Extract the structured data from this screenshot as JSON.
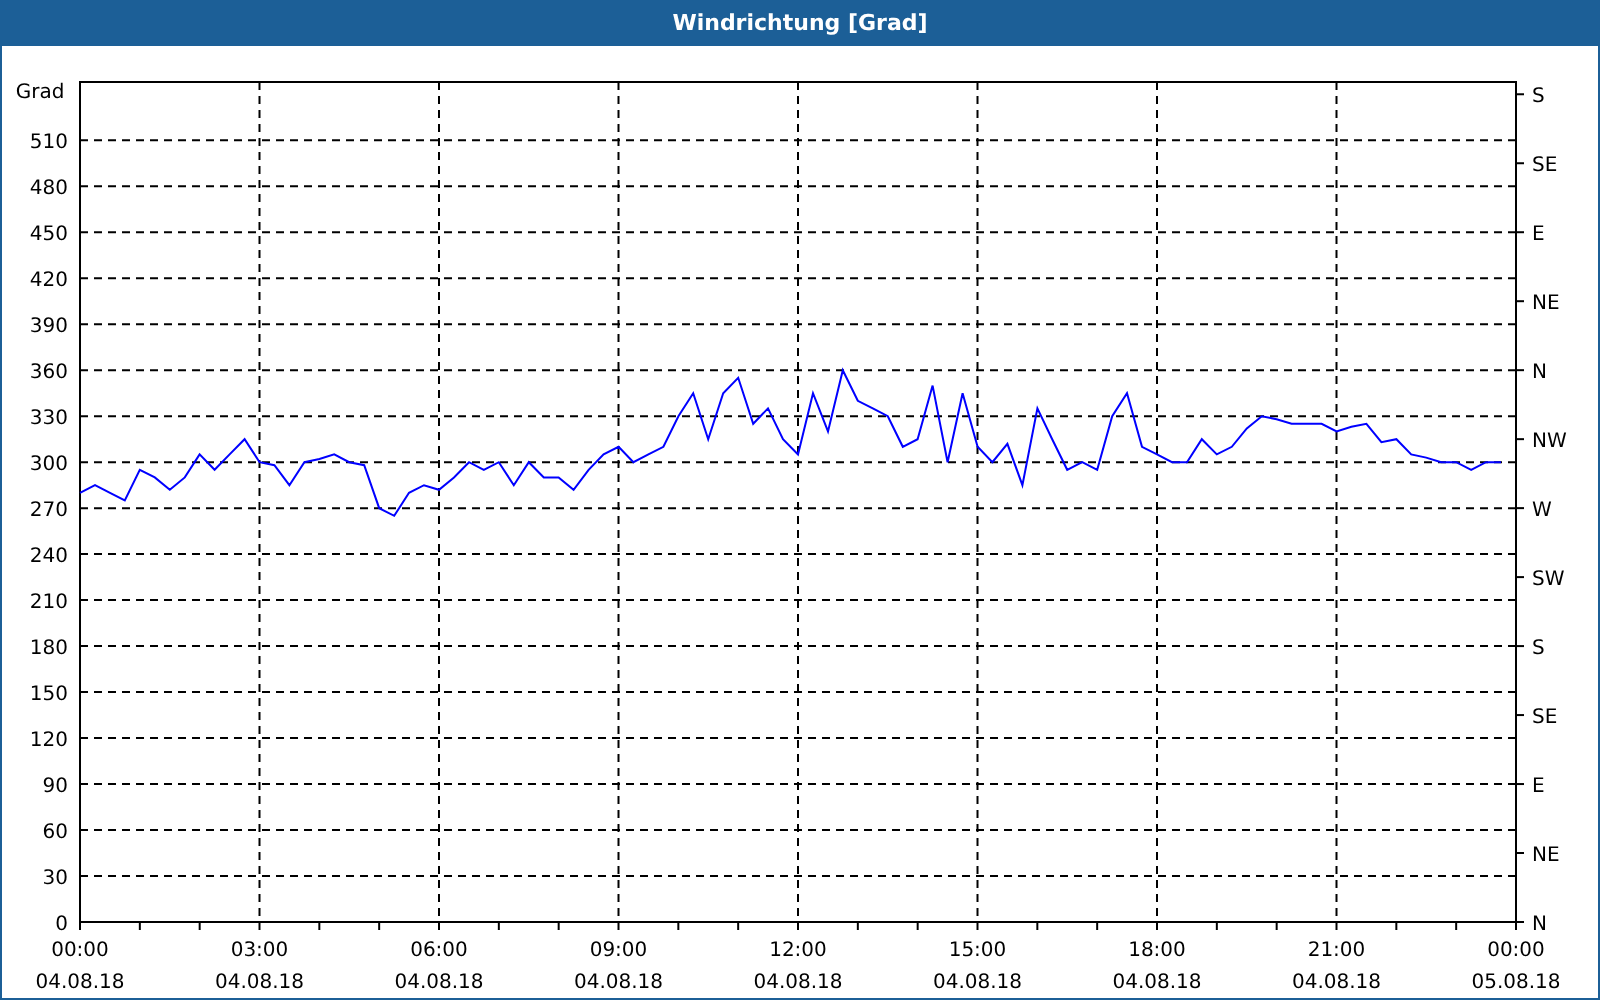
{
  "window": {
    "title": "Windrichtung [Grad]"
  },
  "chart": {
    "chart_data": {
      "type": "line",
      "ylabel": "Grad",
      "grid": true,
      "x": [
        0,
        0.25,
        0.5,
        0.75,
        1,
        1.25,
        1.5,
        1.75,
        2,
        2.25,
        2.5,
        2.75,
        3,
        3.25,
        3.5,
        3.75,
        4,
        4.25,
        4.5,
        4.75,
        5,
        5.25,
        5.5,
        5.75,
        6,
        6.25,
        6.5,
        6.75,
        7,
        7.25,
        7.5,
        7.75,
        8,
        8.25,
        8.5,
        8.75,
        9,
        9.25,
        9.5,
        9.75,
        10,
        10.25,
        10.5,
        10.75,
        11,
        11.25,
        11.5,
        11.75,
        12,
        12.25,
        12.5,
        12.75,
        13,
        13.25,
        13.5,
        13.75,
        14,
        14.25,
        14.5,
        14.75,
        15,
        15.25,
        15.5,
        15.75,
        16,
        16.25,
        16.5,
        16.75,
        17,
        17.25,
        17.5,
        17.75,
        18,
        18.25,
        18.5,
        18.75,
        19,
        19.25,
        19.5,
        19.75,
        20,
        20.25,
        20.5,
        20.75,
        21,
        21.25,
        21.5,
        21.75,
        22,
        22.25,
        22.5,
        22.75,
        23,
        23.25,
        23.5,
        23.75
      ],
      "series": [
        {
          "color": "#0000ff",
          "values": [
            280,
            285,
            280,
            275,
            295,
            290,
            282,
            290,
            305,
            295,
            305,
            315,
            300,
            298,
            285,
            300,
            302,
            305,
            300,
            298,
            270,
            265,
            280,
            285,
            282,
            290,
            300,
            295,
            300,
            285,
            300,
            290,
            290,
            282,
            295,
            305,
            310,
            300,
            305,
            310,
            330,
            345,
            315,
            345,
            355,
            325,
            335,
            315,
            305,
            345,
            320,
            360,
            340,
            335,
            330,
            310,
            315,
            350,
            300,
            345,
            310,
            300,
            312,
            285,
            335,
            315,
            295,
            300,
            295,
            330,
            345,
            310,
            305,
            300,
            300,
            315,
            305,
            310,
            322,
            330,
            328,
            325,
            325,
            325,
            320,
            323,
            325,
            313,
            315,
            305,
            303,
            300,
            300,
            295,
            300,
            300
          ]
        }
      ],
      "xlim": [
        0,
        24
      ],
      "ylim": [
        0,
        548
      ],
      "xticks": [
        {
          "value": 0,
          "label": "00:00"
        },
        {
          "value": 3,
          "label": "03:00"
        },
        {
          "value": 6,
          "label": "06:00"
        },
        {
          "value": 9,
          "label": "09:00"
        },
        {
          "value": 12,
          "label": "12:00"
        },
        {
          "value": 15,
          "label": "15:00"
        },
        {
          "value": 18,
          "label": "18:00"
        },
        {
          "value": 21,
          "label": "21:00"
        },
        {
          "value": 24,
          "label": "00:00"
        }
      ],
      "yticks": [
        0,
        30,
        60,
        90,
        120,
        150,
        180,
        210,
        240,
        270,
        300,
        330,
        360,
        390,
        420,
        450,
        480,
        510
      ]
    },
    "x_dates": [
      "04.08.18",
      "04.08.18",
      "04.08.18",
      "04.08.18",
      "04.08.18",
      "04.08.18",
      "04.08.18",
      "04.08.18",
      "05.08.18"
    ],
    "compass_labels": [
      "S",
      "SE",
      "E",
      "NE",
      "N",
      "NW",
      "W",
      "SW",
      "S",
      "SE",
      "E",
      "NE",
      "N"
    ]
  }
}
